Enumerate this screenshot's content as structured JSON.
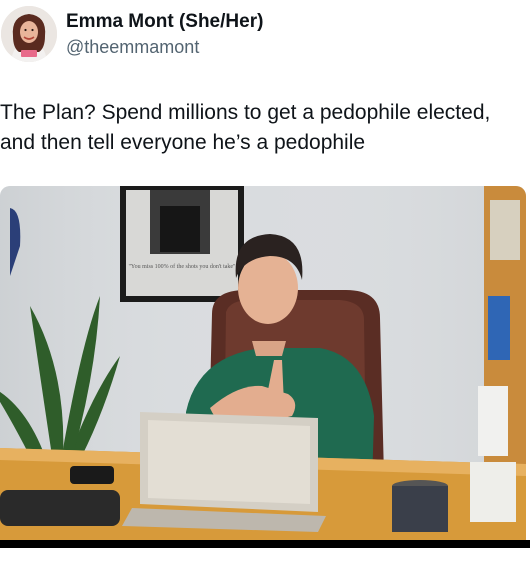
{
  "author": {
    "display_name": "Emma Mont (She/Her)",
    "handle": "@theemmamont",
    "avatar_icon": "avatar-photo"
  },
  "tweet": {
    "text": "The Plan? Spend millions to get a pedophile elected, and then tell everyone he’s a pedophile"
  },
  "media": {
    "type": "photo",
    "poster_caption": "\"You miss 100% of the shots you don't take\""
  },
  "colors": {
    "text_primary": "#0f1419",
    "text_secondary": "#536471",
    "background": "#ffffff"
  }
}
